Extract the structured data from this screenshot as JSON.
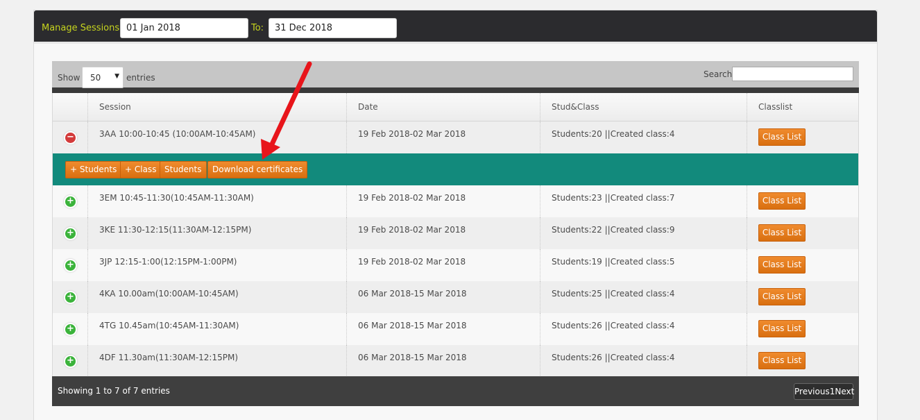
{
  "toolbar": {
    "label": "Manage Sessions:",
    "from_value": "01 Jan 2018",
    "to_label": "To:",
    "to_value": "31 Dec 2018"
  },
  "controls": {
    "show_label": "Show",
    "entries_value": "50",
    "entries_label": "entries",
    "search_label": "Search:",
    "search_value": ""
  },
  "table": {
    "headers": [
      "Session",
      "Date",
      "Stud&Class",
      "Classlist"
    ],
    "classlist_button": "Class List",
    "rows": [
      {
        "session": "3AA 10:00-10:45 (10:00AM-10:45AM)",
        "date": "19 Feb 2018-02 Mar 2018",
        "stud": "Students:20 ||Created class:4",
        "expanded": true
      },
      {
        "session": "3EM 10:45-11:30(10:45AM-11:30AM)",
        "date": "19 Feb 2018-02 Mar 2018",
        "stud": "Students:23 ||Created class:7",
        "expanded": false
      },
      {
        "session": "3KE 11:30-12:15(11:30AM-12:15PM)",
        "date": "19 Feb 2018-02 Mar 2018",
        "stud": "Students:22 ||Created class:9",
        "expanded": false
      },
      {
        "session": "3JP 12:15-1:00(12:15PM-1:00PM)",
        "date": "19 Feb 2018-02 Mar 2018",
        "stud": "Students:19 ||Created class:5",
        "expanded": false
      },
      {
        "session": "4KA 10.00am(10:00AM-10:45AM)",
        "date": "06 Mar 2018-15 Mar 2018",
        "stud": "Students:25 ||Created class:4",
        "expanded": false
      },
      {
        "session": "4TG 10.45am(10:45AM-11:30AM)",
        "date": "06 Mar 2018-15 Mar 2018",
        "stud": "Students:26 ||Created class:4",
        "expanded": false
      },
      {
        "session": "4DF 11.30am(11:30AM-12:15PM)",
        "date": "06 Mar 2018-15 Mar 2018",
        "stud": "Students:26 ||Created class:4",
        "expanded": false
      }
    ],
    "actions": [
      "+ Students",
      "+ Class",
      "Students",
      "Download certificates"
    ]
  },
  "footer": {
    "info": "Showing 1 to 7 of 7 entries",
    "pager": "Previous1Next"
  },
  "colors": {
    "accent_orange": "#e67e22",
    "action_row": "#128a7c",
    "label_green": "#c6d41e",
    "arrow_red": "#e8151b"
  },
  "icons": {
    "collapse": "minus-circle-icon",
    "expand": "plus-circle-icon",
    "dropdown": "caret-down-icon",
    "annotation": "red-arrow-icon"
  }
}
